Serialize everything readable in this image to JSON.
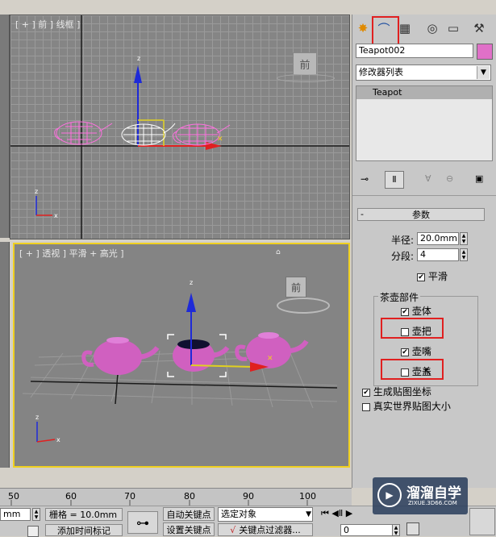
{
  "top_viewport": {
    "label": "[ + ] 前 ] 线框 ]",
    "viewcube": "前"
  },
  "persp_viewport": {
    "label": "[ + ] 透视 ] 平滑 + 高光 ]",
    "viewcube": "前"
  },
  "panel": {
    "object_name": "Teapot002",
    "modifier_list": "修改器列表",
    "stack_item": "Teapot",
    "rollout_title": "参数",
    "radius_label": "半径:",
    "radius_value": "20.0mm",
    "segments_label": "分段:",
    "segments_value": "4",
    "smooth_label": "平滑",
    "parts_group": "茶壶部件",
    "body_label": "壶体",
    "handle_label": "壶把",
    "spout_label": "壶嘴",
    "lid_label": "壶盖",
    "gen_map_label": "生成贴图坐标",
    "real_world_label": "真实世界贴图大小"
  },
  "timeline": {
    "ticks": [
      "50",
      "60",
      "70",
      "80",
      "90",
      "100"
    ]
  },
  "bottom": {
    "spin_value": "mm",
    "grid_label": "栅格 = 10.0mm",
    "auto_key": "自动关键点",
    "set_key": "设置关键点",
    "selection": "选定对象",
    "key_filters": "关键点过滤器...",
    "add_time_tag": "添加时间标记",
    "frame_value": "0"
  },
  "watermark": {
    "title": "溜溜自学",
    "url": "ZIXUE.3D66.COM"
  },
  "colors": {
    "selection_box": "#e02020",
    "active_border": "#f0d020",
    "teapot": "#e070c8"
  }
}
